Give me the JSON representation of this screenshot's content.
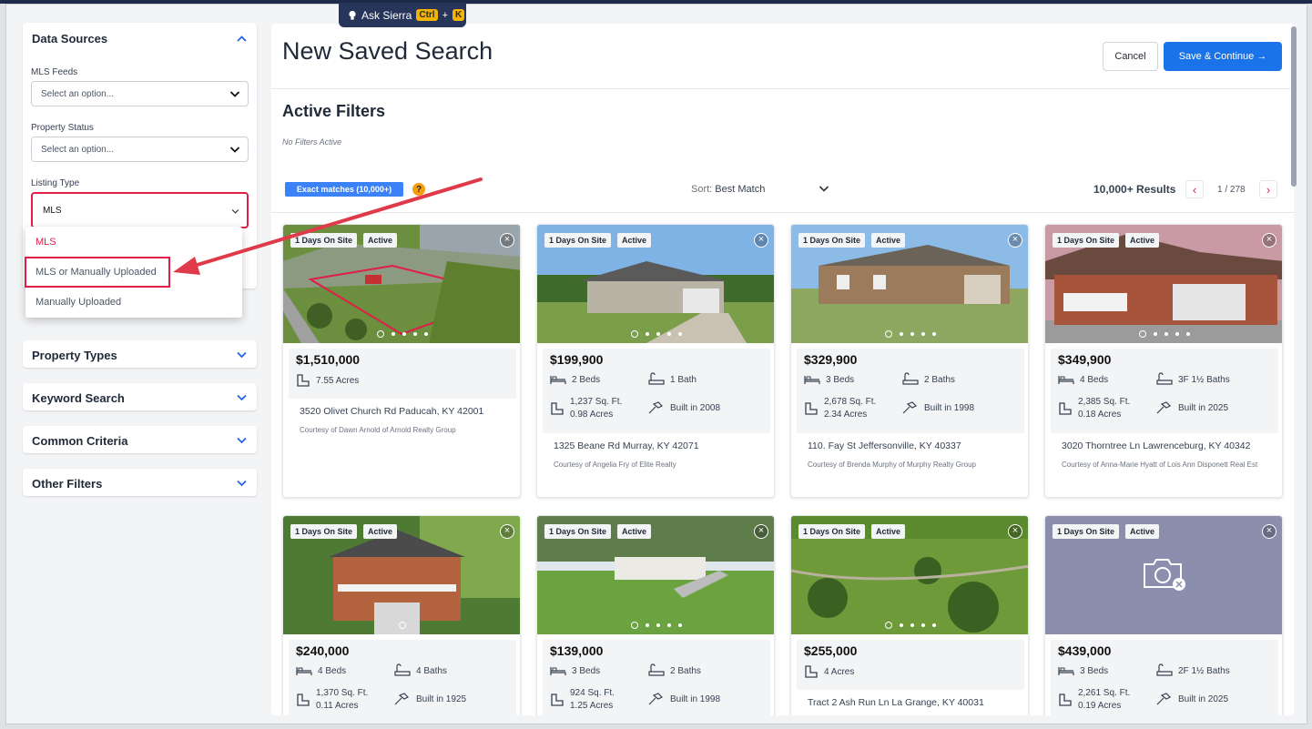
{
  "ask": {
    "label": "Ask Sierra",
    "key1": "Ctrl",
    "plus": "+",
    "key2": "K"
  },
  "sidebar": {
    "data_sources": {
      "title": "Data Sources",
      "mls_feeds": {
        "label": "MLS Feeds",
        "placeholder": "Select an option..."
      },
      "property_status": {
        "label": "Property Status",
        "placeholder": "Select an option..."
      },
      "listing_type": {
        "label": "Listing Type",
        "value": "MLS",
        "options": [
          "MLS",
          "MLS or Manually Uploaded",
          "Manually Uploaded"
        ]
      }
    },
    "sections": [
      "Property Types",
      "Keyword Search",
      "Common Criteria",
      "Other Filters"
    ]
  },
  "header": {
    "title": "New Saved Search",
    "cancel": "Cancel",
    "save": "Save & Continue"
  },
  "filters": {
    "title": "Active Filters",
    "none": "No Filters Active"
  },
  "toolbar": {
    "exact": "Exact matches (10,000+)",
    "help": "?",
    "sort_label": "Sort:",
    "sort_value": "Best Match",
    "results": "10,000+ Results",
    "page": "1 / 278"
  },
  "colors": {
    "accent": "#1a73e8",
    "danger": "#e11d48"
  },
  "listings": [
    {
      "days": "1 Days On Site",
      "status": "Active",
      "price": "$1,510,000",
      "area": "7.55 Acres",
      "address": "3520 Olivet Church Rd Paducah, KY 42001",
      "courtesy": "Courtesy of Dawn Arnold of Arnold Realty Group"
    },
    {
      "days": "1 Days On Site",
      "status": "Active",
      "price": "$199,900",
      "beds": "2 Beds",
      "baths": "1 Bath",
      "sqft": "1,237 Sq. Ft.",
      "acres": "0.98 Acres",
      "built": "Built in 2008",
      "address": "1325 Beane Rd Murray, KY 42071",
      "courtesy": "Courtesy of Angelia Fry of Elite Realty"
    },
    {
      "days": "1 Days On Site",
      "status": "Active",
      "price": "$329,900",
      "beds": "3 Beds",
      "baths": "2 Baths",
      "sqft": "2,678 Sq. Ft.",
      "acres": "2.34 Acres",
      "built": "Built in 1998",
      "address": "110. Fay St Jeffersonville, KY 40337",
      "courtesy": "Courtesy of Brenda Murphy of Murphy Realty Group"
    },
    {
      "days": "1 Days On Site",
      "status": "Active",
      "price": "$349,900",
      "beds": "4 Beds",
      "baths": "3F 1½ Baths",
      "sqft": "2,385 Sq. Ft.",
      "acres": "0.18 Acres",
      "built": "Built in 2025",
      "address": "3020 Thorntree Ln Lawrenceburg, KY 40342",
      "courtesy": "Courtesy of Anna-Marie Hyatt of Lois Ann Disponett Real Est"
    },
    {
      "days": "1 Days On Site",
      "status": "Active",
      "price": "$240,000",
      "beds": "4 Beds",
      "baths": "4 Baths",
      "sqft": "1,370 Sq. Ft.",
      "acres": "0.11 Acres",
      "built": "Built in 1925"
    },
    {
      "days": "1 Days On Site",
      "status": "Active",
      "price": "$139,000",
      "beds": "3 Beds",
      "baths": "2 Baths",
      "sqft": "924 Sq. Ft.",
      "acres": "1.25 Acres",
      "built": "Built in 1998"
    },
    {
      "days": "1 Days On Site",
      "status": "Active",
      "price": "$255,000",
      "area": "4 Acres",
      "address": "Tract 2 Ash Run Ln La Grange, KY 40031"
    },
    {
      "days": "1 Days On Site",
      "status": "Active",
      "price": "$439,000",
      "beds": "3 Beds",
      "baths": "2F 1½ Baths",
      "sqft": "2,261 Sq. Ft.",
      "acres": "0.19 Acres",
      "built": "Built in 2025"
    }
  ]
}
